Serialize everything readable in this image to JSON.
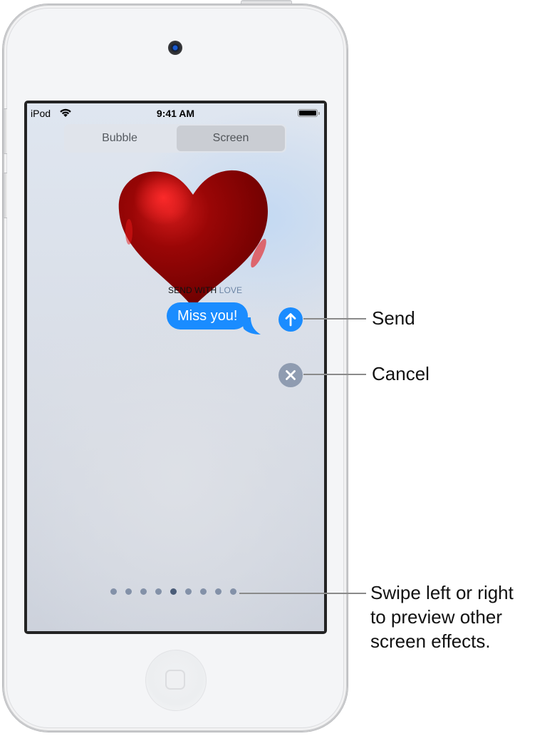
{
  "device": {
    "name": "iPod touch"
  },
  "status_bar": {
    "carrier": "iPod",
    "time": "9:41 AM",
    "wifi_icon": "wifi-icon",
    "battery_icon": "battery-full-icon"
  },
  "effect_tabs": {
    "items": [
      {
        "label": "Bubble",
        "selected": false
      },
      {
        "label": "Screen",
        "selected": true
      }
    ]
  },
  "effect": {
    "name_part1": "SEND WITH",
    "name_part2": "LOVE",
    "visual": "heart"
  },
  "message": {
    "text": "Miss you!",
    "bubble_color": "#1a8cff"
  },
  "actions": {
    "send_icon": "arrow-up-icon",
    "cancel_icon": "close-icon",
    "send_color": "#1a8cff",
    "cancel_color": "#8f9cb1"
  },
  "page_indicator": {
    "count": 9,
    "active_index": 4
  },
  "callouts": {
    "send": "Send",
    "cancel": "Cancel",
    "swipe_line1": "Swipe left or right",
    "swipe_line2": "to preview other",
    "swipe_line3": "screen effects."
  }
}
